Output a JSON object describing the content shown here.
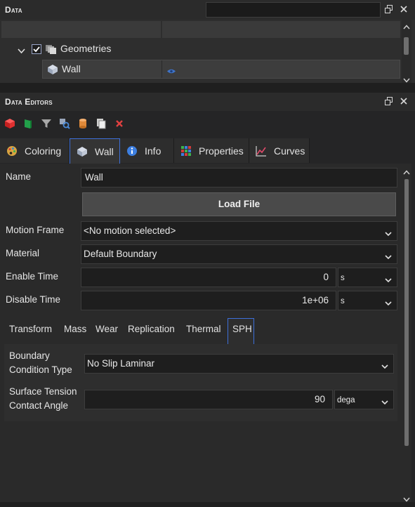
{
  "data_panel": {
    "title": "Data",
    "search_value": "",
    "tree": [
      {
        "label": "Geometries",
        "checked": true
      },
      {
        "label": "Wall"
      }
    ]
  },
  "editors_panel": {
    "title": "Data Editors"
  },
  "tabs": [
    {
      "label": "Coloring",
      "icon": "palette-icon"
    },
    {
      "label": "Wall",
      "icon": "wall-geometry-icon",
      "active": true
    },
    {
      "label": "Info",
      "icon": "info-icon"
    },
    {
      "label": "Properties",
      "icon": "properties-grid-icon"
    },
    {
      "label": "Curves",
      "icon": "curves-chart-icon"
    }
  ],
  "form": {
    "name_label": "Name",
    "name_value": "Wall",
    "load_file_label": "Load File",
    "motion_frame_label": "Motion Frame",
    "motion_frame_value": "<No motion selected>",
    "material_label": "Material",
    "material_value": "Default Boundary",
    "enable_time_label": "Enable Time",
    "enable_time_value": "0",
    "enable_time_unit": "s",
    "disable_time_label": "Disable Time",
    "disable_time_value": "1e+06",
    "disable_time_unit": "s"
  },
  "subtabs": [
    "Transform",
    "Mass",
    "Wear",
    "Replication",
    "Thermal",
    "SPH"
  ],
  "sph": {
    "boundary_label_1": "Boundary",
    "boundary_label_2": "Condition Type",
    "boundary_value": "No Slip Laminar",
    "surface_label_1": "Surface Tension",
    "surface_label_2": "Contact Angle",
    "surface_value": "90",
    "surface_unit": "dega"
  },
  "colors": {
    "accent": "#3d6fd9",
    "background": "#252526",
    "close_red": "#e04040"
  }
}
